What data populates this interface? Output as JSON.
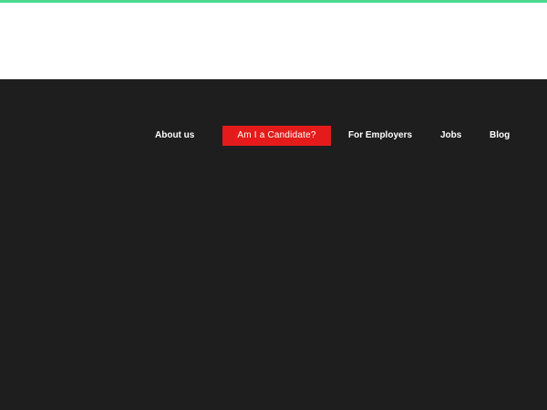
{
  "colors": {
    "accent": "#4cd991",
    "header_background": "#ffffff",
    "body_background": "#1e1e1e",
    "highlight": "#e51b1b",
    "nav_text": "#ffffff"
  },
  "nav": {
    "items": [
      {
        "label": "About us"
      },
      {
        "label": "Am I a Candidate?",
        "highlighted": true
      },
      {
        "label": "For Employers"
      },
      {
        "label": "Jobs"
      },
      {
        "label": "Blog"
      }
    ]
  }
}
